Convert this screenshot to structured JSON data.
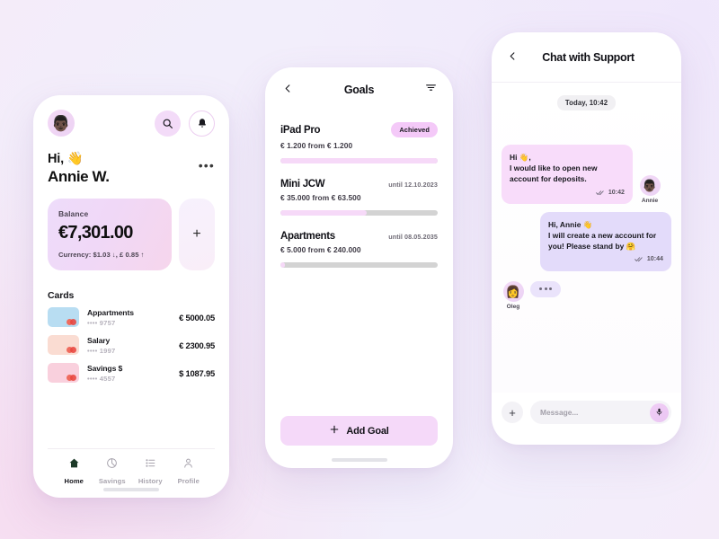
{
  "theme": {
    "accent_pink": "#f5d9f9",
    "accent_lilac": "#e3dbfa",
    "bg_start": "#f3ecfb",
    "bg_pink": "#f6dcf0",
    "text_dark": "#111117",
    "muted": "#a8a4ae"
  },
  "home": {
    "avatar_emoji": "👨🏿",
    "search_icon": "search-icon",
    "bell_icon": "bell-icon",
    "greeting": "Hi, 👋",
    "name": "Annie W.",
    "more_label": "•••",
    "balance": {
      "label": "Balance",
      "amount": "€7,301.00",
      "currency": "Currency: $1.03 ↓,  £ 0.85 ↑",
      "add_label": "+"
    },
    "cards_title": "Cards",
    "cards": [
      {
        "name": "Appartments",
        "digits": "•••• 9757",
        "amount": "€ 5000.05",
        "color": "#b8ddf2"
      },
      {
        "name": "Salary",
        "digits": "•••• 1997",
        "amount": "€ 2300.95",
        "color": "#fadcd2"
      },
      {
        "name": "Savings $",
        "digits": "•••• 4557",
        "amount": "$ 1087.95",
        "color": "#f9d0dd"
      }
    ],
    "tabs": [
      {
        "label": "Home",
        "icon": "home-icon",
        "active": true
      },
      {
        "label": "Savings",
        "icon": "pie-chart-icon",
        "active": false
      },
      {
        "label": "History",
        "icon": "list-icon",
        "active": false
      },
      {
        "label": "Profile",
        "icon": "person-icon",
        "active": false
      }
    ]
  },
  "goals": {
    "back_icon": "chevron-left-icon",
    "title": "Goals",
    "filter_icon": "filter-icon",
    "items": [
      {
        "name": "iPad Pro",
        "status": "Achieved",
        "date": "",
        "summary": "€ 1.200 from € 1.200",
        "progress": 100
      },
      {
        "name": "Mini JCW",
        "status": "",
        "date": "until 12.10.2023",
        "summary": "€ 35.000 from € 63.500",
        "progress": 55
      },
      {
        "name": "Apartments",
        "status": "",
        "date": "until 08.05.2035",
        "summary": "€ 5.000 from € 240.000",
        "progress": 2
      }
    ],
    "add_button": "Add Goal",
    "add_icon": "plus-icon"
  },
  "chat": {
    "back_icon": "chevron-left-icon",
    "title": "Chat with Support",
    "daystamp": "Today, 10:42",
    "messages": [
      {
        "side": "in",
        "text": "Hi 👋,\nI would like to open new account for deposits.",
        "time": "10:42",
        "check_icon": "double-check-icon",
        "author": "Annie",
        "avatar_emoji": "👨🏿"
      },
      {
        "side": "out",
        "text": "Hi, Annie 👋\nI will create a new account for you! Please stand by 🤗",
        "time": "10:44",
        "check_icon": "double-check-icon",
        "author": "",
        "avatar_emoji": ""
      }
    ],
    "typing": {
      "author": "Oleg",
      "avatar_emoji": "👩",
      "dots": "•••"
    },
    "composer": {
      "attach_label": "+",
      "placeholder": "Message...",
      "mic_icon": "microphone-icon"
    }
  }
}
